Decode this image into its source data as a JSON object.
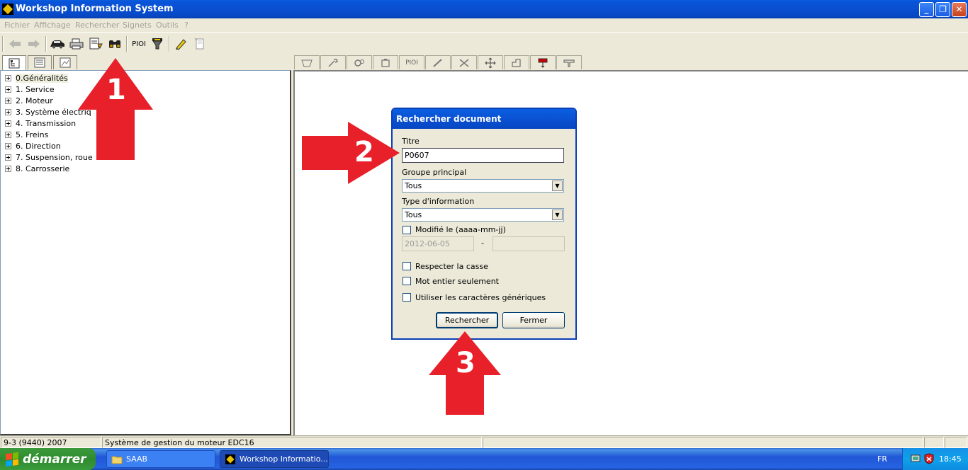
{
  "window": {
    "title": "Workshop Information System",
    "buttons": {
      "minimize": "_",
      "maximize": "❐",
      "close": "✕"
    }
  },
  "menu": [
    "Fichier",
    "Affichage",
    "Rechercher",
    "Signets",
    "Outils",
    "?"
  ],
  "toolbar": {
    "items": [
      "back-arrow-icon",
      "forward-arrow-icon",
      "car-icon",
      "print-icon",
      "document-download-icon",
      "binoculars-search-icon",
      "pioi-label",
      "filter-icon",
      "pencil-icon",
      "document-edit-icon"
    ],
    "pioi_label": "PIOI"
  },
  "right_tabs": {
    "items": [
      "body-icon",
      "wrench-icon",
      "gears-icon",
      "engine-icon",
      "pioi-tab",
      "tools-icon",
      "adjust-icon",
      "cross-arrows-icon",
      "hand-icon",
      "diagnostic-icon",
      "clamp-icon"
    ],
    "pioi_label": "PIOI"
  },
  "tree": {
    "items": [
      {
        "label": "0.Généralités"
      },
      {
        "label": "1. Service"
      },
      {
        "label": "2. Moteur"
      },
      {
        "label": "3. Système électriq"
      },
      {
        "label": "4. Transmission"
      },
      {
        "label": "5. Freins"
      },
      {
        "label": "6. Direction"
      },
      {
        "label": "7. Suspension, roue"
      },
      {
        "label": "8. Carrosserie"
      }
    ]
  },
  "dialog": {
    "title": "Rechercher document",
    "titre_label": "Titre",
    "titre_value": "P0607",
    "groupe_label": "Groupe principal",
    "groupe_value": "Tous",
    "type_label": "Type d'information",
    "type_value": "Tous",
    "modifie_label": "Modifié le (aaaa-mm-jj)",
    "date_from": "2012-06-05",
    "date_sep": "-",
    "date_to": "",
    "respecter_label": "Respecter la casse",
    "mot_label": "Mot entier seulement",
    "utiliser_label": "Utiliser les caractères génériques",
    "search_button": "Rechercher",
    "close_button": "Fermer"
  },
  "annotations": [
    "1",
    "2",
    "3"
  ],
  "colors": {
    "annotation_red": "#e8202a",
    "title_blue": "#0a4fd0"
  },
  "statusbar": {
    "vehicle": "9-3 (9440) 2007",
    "system": "Système de gestion du moteur EDC16"
  },
  "taskbar": {
    "start_label": "démarrer",
    "tasks": [
      "SAAB",
      "Workshop Informatio..."
    ],
    "language": "FR",
    "clock": "18:45"
  }
}
